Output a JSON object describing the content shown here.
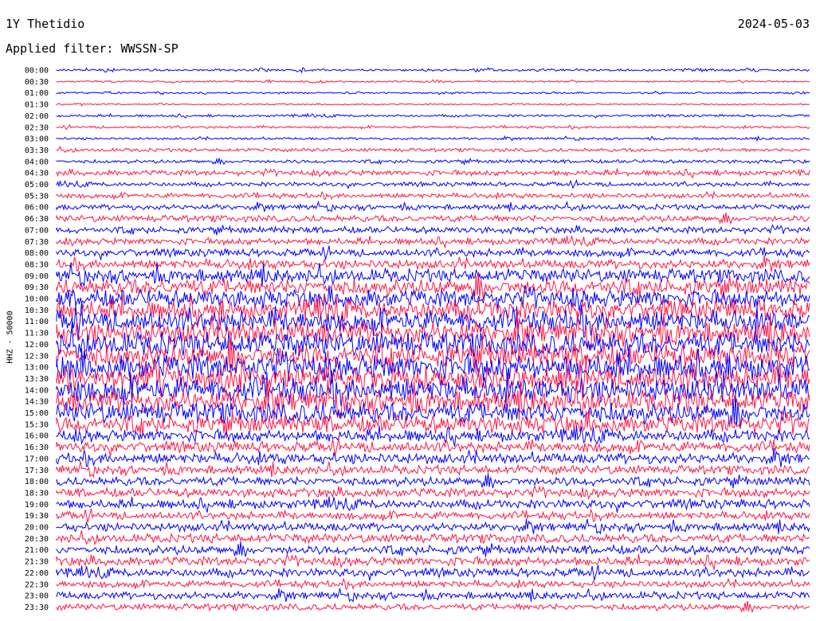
{
  "header": {
    "station": "1Y Thetidio",
    "date": "2024-05-03",
    "filter": "Applied filter: WWSSN-SP"
  },
  "channel_label": "HHZ - 50000",
  "colors": {
    "blue": "#0000ff",
    "red": "#ff1744"
  },
  "chart_data": {
    "type": "line",
    "title": "1Y Thetidio",
    "subtitle": "Applied filter: WWSSN-SP",
    "ylabel": "HHZ - 50000",
    "xlabel": "",
    "categories": [
      "00:00",
      "00:30",
      "01:00",
      "01:30",
      "02:00",
      "02:30",
      "03:00",
      "03:30",
      "04:00",
      "04:30",
      "05:00",
      "05:30",
      "06:00",
      "06:30",
      "07:00",
      "07:30",
      "08:00",
      "08:30",
      "09:00",
      "09:30",
      "10:00",
      "10:30",
      "11:00",
      "11:30",
      "12:00",
      "12:30",
      "13:00",
      "13:30",
      "14:00",
      "14:30",
      "15:00",
      "15:30",
      "16:00",
      "16:30",
      "17:00",
      "17:30",
      "18:00",
      "18:30",
      "19:00",
      "19:30",
      "20:00",
      "20:30",
      "21:00",
      "21:30",
      "22:00",
      "22:30",
      "23:00",
      "23:30"
    ],
    "row_colors": [
      "blue",
      "red"
    ],
    "relative_amplitude": [
      0.08,
      0.06,
      0.06,
      0.05,
      0.08,
      0.08,
      0.08,
      0.12,
      0.12,
      0.18,
      0.14,
      0.16,
      0.18,
      0.22,
      0.22,
      0.22,
      0.25,
      0.3,
      0.45,
      0.55,
      0.6,
      0.65,
      0.7,
      0.75,
      0.8,
      0.8,
      0.85,
      0.8,
      0.8,
      0.75,
      0.7,
      0.6,
      0.4,
      0.35,
      0.35,
      0.3,
      0.3,
      0.3,
      0.3,
      0.25,
      0.28,
      0.3,
      0.3,
      0.3,
      0.28,
      0.22,
      0.25,
      0.22
    ],
    "grid": false,
    "legend": "none"
  }
}
